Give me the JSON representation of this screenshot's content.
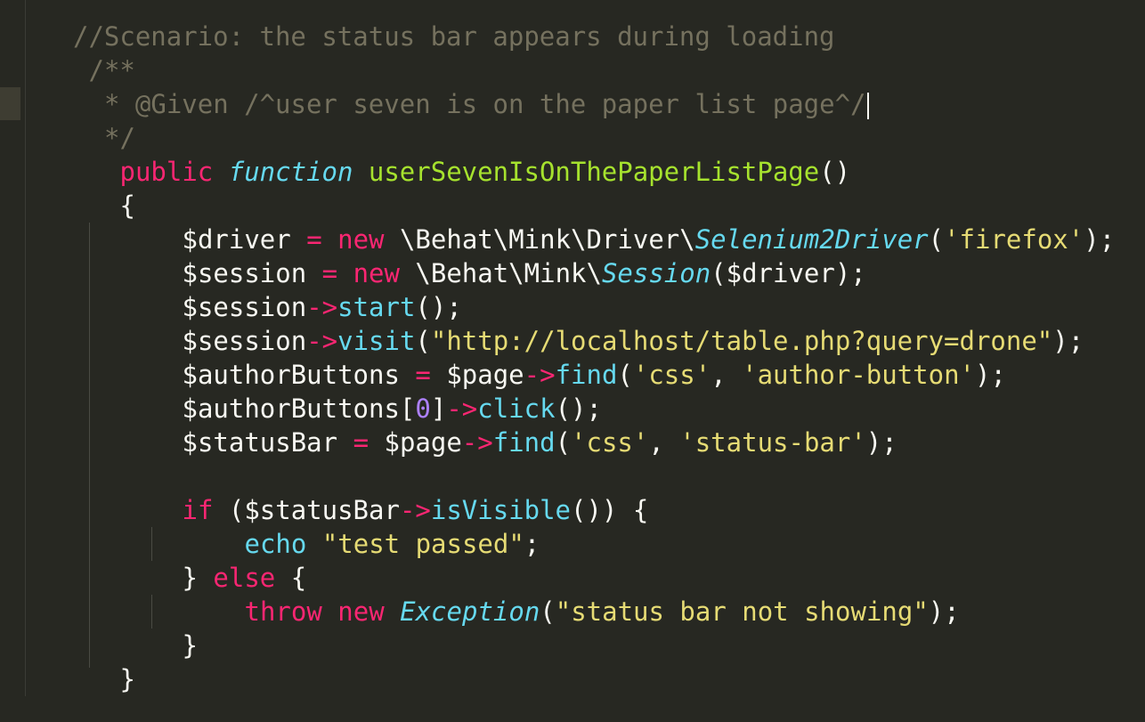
{
  "editor": {
    "theme": "Monokai",
    "colors": {
      "background": "#272822",
      "comment": "#75715e",
      "keyword": "#f92672",
      "function": "#a6e22e",
      "type": "#66d9ef",
      "string": "#e6db74",
      "number": "#ae81ff",
      "plain": "#f8f8f2"
    },
    "lines": [
      {
        "name": "code-line-1",
        "indent": 0,
        "tokens": [
          {
            "t": "//Scenario: the status bar appears during loading",
            "c": "cm"
          }
        ]
      },
      {
        "name": "code-line-2",
        "indent": 1,
        "tokens": [
          {
            "t": "/**",
            "c": "cm"
          }
        ]
      },
      {
        "name": "code-line-3",
        "indent": 2,
        "cursor": true,
        "tokens": [
          {
            "t": "* @Given /^user seven is on the paper list page^/",
            "c": "cm"
          }
        ]
      },
      {
        "name": "code-line-4",
        "indent": 2,
        "tokens": [
          {
            "t": "*/",
            "c": "cm"
          }
        ]
      },
      {
        "name": "code-line-5",
        "indent": 3,
        "tokens": [
          {
            "t": "public",
            "c": "kw"
          },
          {
            "t": " ",
            "c": "p"
          },
          {
            "t": "function",
            "c": "st"
          },
          {
            "t": " ",
            "c": "p"
          },
          {
            "t": "userSevenIsOnThePaperListPage",
            "c": "fn"
          },
          {
            "t": "()",
            "c": "p"
          }
        ]
      },
      {
        "name": "code-line-6",
        "indent": 3,
        "tokens": [
          {
            "t": "{",
            "c": "p"
          }
        ]
      },
      {
        "name": "code-line-7",
        "indent": 7,
        "tokens": [
          {
            "t": "$driver ",
            "c": "p"
          },
          {
            "t": "=",
            "c": "op"
          },
          {
            "t": " ",
            "c": "p"
          },
          {
            "t": "new",
            "c": "kw"
          },
          {
            "t": " \\Behat\\Mink\\Driver\\",
            "c": "p"
          },
          {
            "t": "Selenium2Driver",
            "c": "cls"
          },
          {
            "t": "(",
            "c": "p"
          },
          {
            "t": "'firefox'",
            "c": "s"
          },
          {
            "t": ");",
            "c": "p"
          }
        ]
      },
      {
        "name": "code-line-8",
        "indent": 7,
        "tokens": [
          {
            "t": "$session ",
            "c": "p"
          },
          {
            "t": "=",
            "c": "op"
          },
          {
            "t": " ",
            "c": "p"
          },
          {
            "t": "new",
            "c": "kw"
          },
          {
            "t": " \\Behat\\Mink\\",
            "c": "p"
          },
          {
            "t": "Session",
            "c": "cls"
          },
          {
            "t": "($driver);",
            "c": "p"
          }
        ]
      },
      {
        "name": "code-line-9",
        "indent": 7,
        "tokens": [
          {
            "t": "$session",
            "c": "p"
          },
          {
            "t": "->",
            "c": "op"
          },
          {
            "t": "start",
            "c": "mt"
          },
          {
            "t": "();",
            "c": "p"
          }
        ]
      },
      {
        "name": "code-line-10",
        "indent": 7,
        "tokens": [
          {
            "t": "$session",
            "c": "p"
          },
          {
            "t": "->",
            "c": "op"
          },
          {
            "t": "visit",
            "c": "mt"
          },
          {
            "t": "(",
            "c": "p"
          },
          {
            "t": "\"http://localhost/table.php?query=drone\"",
            "c": "s"
          },
          {
            "t": ");",
            "c": "p"
          }
        ]
      },
      {
        "name": "code-line-11",
        "indent": 7,
        "tokens": [
          {
            "t": "$authorButtons ",
            "c": "p"
          },
          {
            "t": "=",
            "c": "op"
          },
          {
            "t": " $page",
            "c": "p"
          },
          {
            "t": "->",
            "c": "op"
          },
          {
            "t": "find",
            "c": "mt"
          },
          {
            "t": "(",
            "c": "p"
          },
          {
            "t": "'css'",
            "c": "s"
          },
          {
            "t": ", ",
            "c": "p"
          },
          {
            "t": "'author-button'",
            "c": "s"
          },
          {
            "t": ");",
            "c": "p"
          }
        ]
      },
      {
        "name": "code-line-12",
        "indent": 7,
        "tokens": [
          {
            "t": "$authorButtons[",
            "c": "p"
          },
          {
            "t": "0",
            "c": "num"
          },
          {
            "t": "]",
            "c": "p"
          },
          {
            "t": "->",
            "c": "op"
          },
          {
            "t": "click",
            "c": "mt"
          },
          {
            "t": "();",
            "c": "p"
          }
        ]
      },
      {
        "name": "code-line-13",
        "indent": 7,
        "tokens": [
          {
            "t": "$statusBar ",
            "c": "p"
          },
          {
            "t": "=",
            "c": "op"
          },
          {
            "t": " $page",
            "c": "p"
          },
          {
            "t": "->",
            "c": "op"
          },
          {
            "t": "find",
            "c": "mt"
          },
          {
            "t": "(",
            "c": "p"
          },
          {
            "t": "'css'",
            "c": "s"
          },
          {
            "t": ", ",
            "c": "p"
          },
          {
            "t": "'status-bar'",
            "c": "s"
          },
          {
            "t": ");",
            "c": "p"
          }
        ]
      },
      {
        "name": "code-line-14",
        "indent": 0,
        "tokens": []
      },
      {
        "name": "code-line-15",
        "indent": 7,
        "tokens": [
          {
            "t": "if",
            "c": "kw"
          },
          {
            "t": " ($statusBar",
            "c": "p"
          },
          {
            "t": "->",
            "c": "op"
          },
          {
            "t": "isVisible",
            "c": "mt"
          },
          {
            "t": "()) {",
            "c": "p"
          }
        ]
      },
      {
        "name": "code-line-16",
        "indent": 11,
        "tokens": [
          {
            "t": "echo",
            "c": "mt"
          },
          {
            "t": " ",
            "c": "p"
          },
          {
            "t": "\"test passed\"",
            "c": "s"
          },
          {
            "t": ";",
            "c": "p"
          }
        ]
      },
      {
        "name": "code-line-17",
        "indent": 7,
        "tokens": [
          {
            "t": "} ",
            "c": "p"
          },
          {
            "t": "else",
            "c": "kw"
          },
          {
            "t": " {",
            "c": "p"
          }
        ]
      },
      {
        "name": "code-line-18",
        "indent": 11,
        "tokens": [
          {
            "t": "throw",
            "c": "kw"
          },
          {
            "t": " ",
            "c": "p"
          },
          {
            "t": "new",
            "c": "kw"
          },
          {
            "t": " ",
            "c": "p"
          },
          {
            "t": "Exception",
            "c": "cls"
          },
          {
            "t": "(",
            "c": "p"
          },
          {
            "t": "\"status bar not showing\"",
            "c": "s"
          },
          {
            "t": ");",
            "c": "p"
          }
        ]
      },
      {
        "name": "code-line-19",
        "indent": 7,
        "tokens": [
          {
            "t": "}",
            "c": "p"
          }
        ]
      },
      {
        "name": "code-line-20",
        "indent": 3,
        "tokens": [
          {
            "t": "}",
            "c": "p"
          }
        ]
      }
    ]
  }
}
